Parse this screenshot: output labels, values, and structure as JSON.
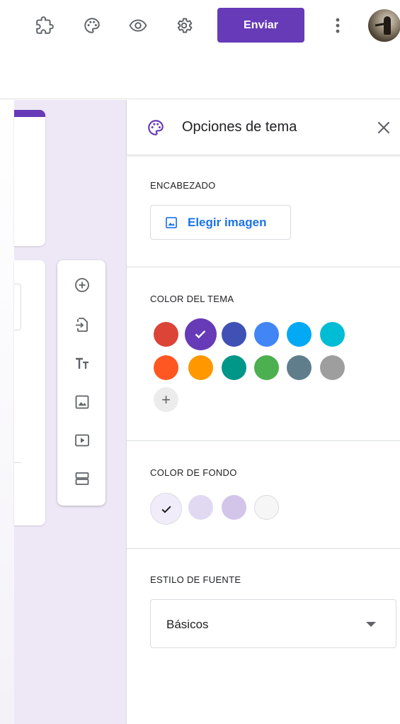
{
  "topbar": {
    "icons": [
      "addon-icon",
      "palette-icon",
      "preview-eye-icon",
      "settings-gear-icon"
    ],
    "send_label": "Enviar",
    "brand_color": "#673ab7"
  },
  "toolbar": {
    "tools": [
      "add-question-icon",
      "import-questions-icon",
      "add-title-icon",
      "add-image-icon",
      "add-video-icon",
      "add-section-icon"
    ]
  },
  "theme_panel": {
    "title": "Opciones de tema",
    "header_section": {
      "label": "ENCABEZADO",
      "choose_image_label": "Elegir imagen"
    },
    "theme_color": {
      "label": "COLOR DEL TEMA",
      "colors": [
        "#db4437",
        "#673ab7",
        "#3f51b5",
        "#4285f4",
        "#03a9f4",
        "#00bcd4",
        "#ff5722",
        "#ff9800",
        "#009688",
        "#4caf50",
        "#607d8b",
        "#9e9e9e"
      ],
      "selected": "#673ab7",
      "add_symbol": "+"
    },
    "background_color": {
      "label": "COLOR DE FONDO",
      "colors": [
        "#f1ecf9",
        "#e1d9f1",
        "#d3c4ea",
        "#f6f6f6"
      ],
      "selected": "#f1ecf9"
    },
    "font_style": {
      "label": "ESTILO DE FUENTE",
      "selected": "Básicos"
    }
  }
}
